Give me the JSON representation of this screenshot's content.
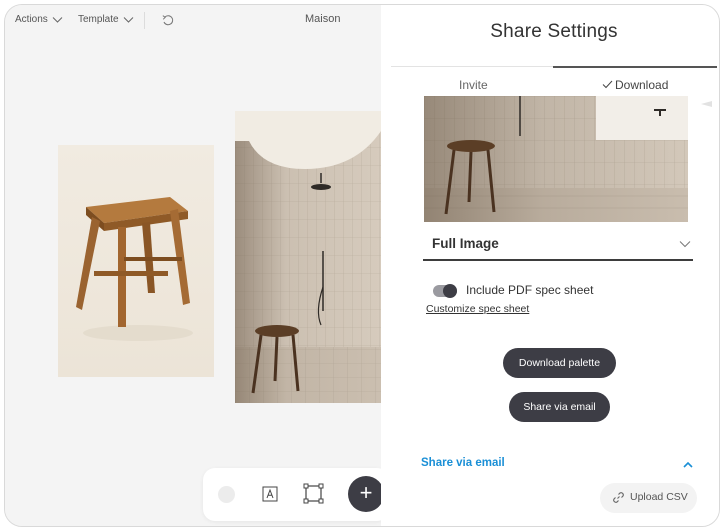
{
  "topbar": {
    "actions_label": "Actions",
    "template_label": "Template",
    "document_title": "Maison"
  },
  "canvas": {
    "images": [
      {
        "subject": "wooden stool on cream background"
      },
      {
        "subject": "tiled shower room with wooden stool"
      }
    ],
    "toolbar": {
      "add_symbol": "+"
    }
  },
  "share_panel": {
    "title": "Share Settings",
    "tabs": [
      {
        "label": "Invite",
        "active": false
      },
      {
        "label": "Download",
        "active": true
      }
    ],
    "image_option": "Full Image",
    "include_pdf": {
      "label": "Include PDF spec sheet",
      "enabled": true
    },
    "customize_link": "Customize spec sheet",
    "download_palette_button": "Download palette",
    "share_email_button": "Share via email",
    "share_email_section": {
      "label": "Share via email",
      "expanded": true
    },
    "upload_csv_button": "Upload CSV"
  },
  "colors": {
    "accent_dark": "#3d3d45",
    "link_blue": "#1a8fd6",
    "canvas_bg": "#f4f4f4"
  },
  "icons": [
    "chevron-down-icon",
    "undo-icon",
    "check-icon",
    "text-tool-icon",
    "frame-tool-icon",
    "plus-icon",
    "chevron-up-icon",
    "link-icon"
  ]
}
